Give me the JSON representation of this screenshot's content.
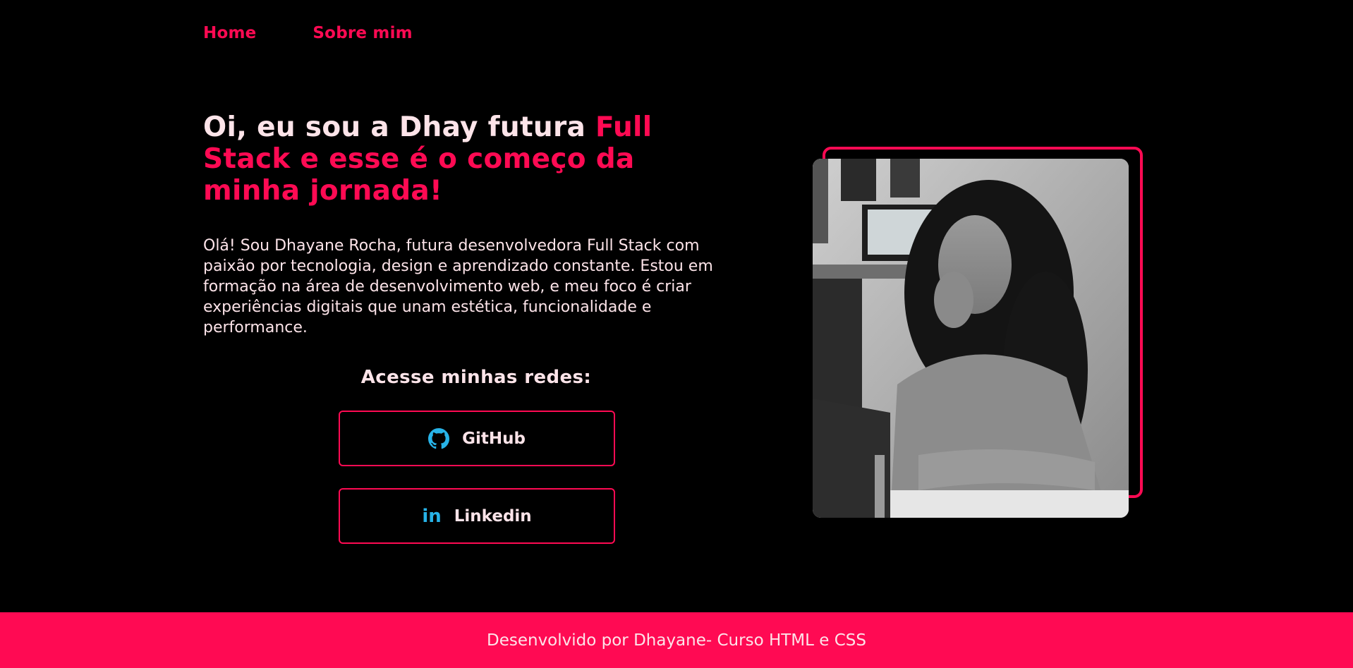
{
  "nav": {
    "items": [
      {
        "label": "Home"
      },
      {
        "label": "Sobre mim"
      }
    ]
  },
  "hero": {
    "title_plain": "Oi, eu sou a Dhay futura ",
    "title_accent": "Full Stack e esse é o começo da minha jornada!",
    "paragraph": "Olá! Sou Dhayane Rocha, futura desenvolvedora Full Stack com paixão por tecnologia, design e aprendizado constante. Estou em formação na área de desenvolvimento web, e meu foco é criar experiências digitais que unam estética, funcionalidade e performance."
  },
  "social": {
    "title": "Acesse minhas redes:",
    "buttons": [
      {
        "label": "GitHub",
        "icon": "github-icon"
      },
      {
        "label": "Linkedin",
        "icon": "linkedin-icon",
        "icon_text": "in"
      }
    ]
  },
  "photo": {
    "alt": "Foto de Dhayane Rocha"
  },
  "footer": {
    "text": "Desenvolvido por Dhayane- Curso HTML e CSS"
  },
  "colors": {
    "background": "#000000",
    "accent": "#ff0a53",
    "text": "#fde4e9",
    "icon": "#27b3e8"
  }
}
